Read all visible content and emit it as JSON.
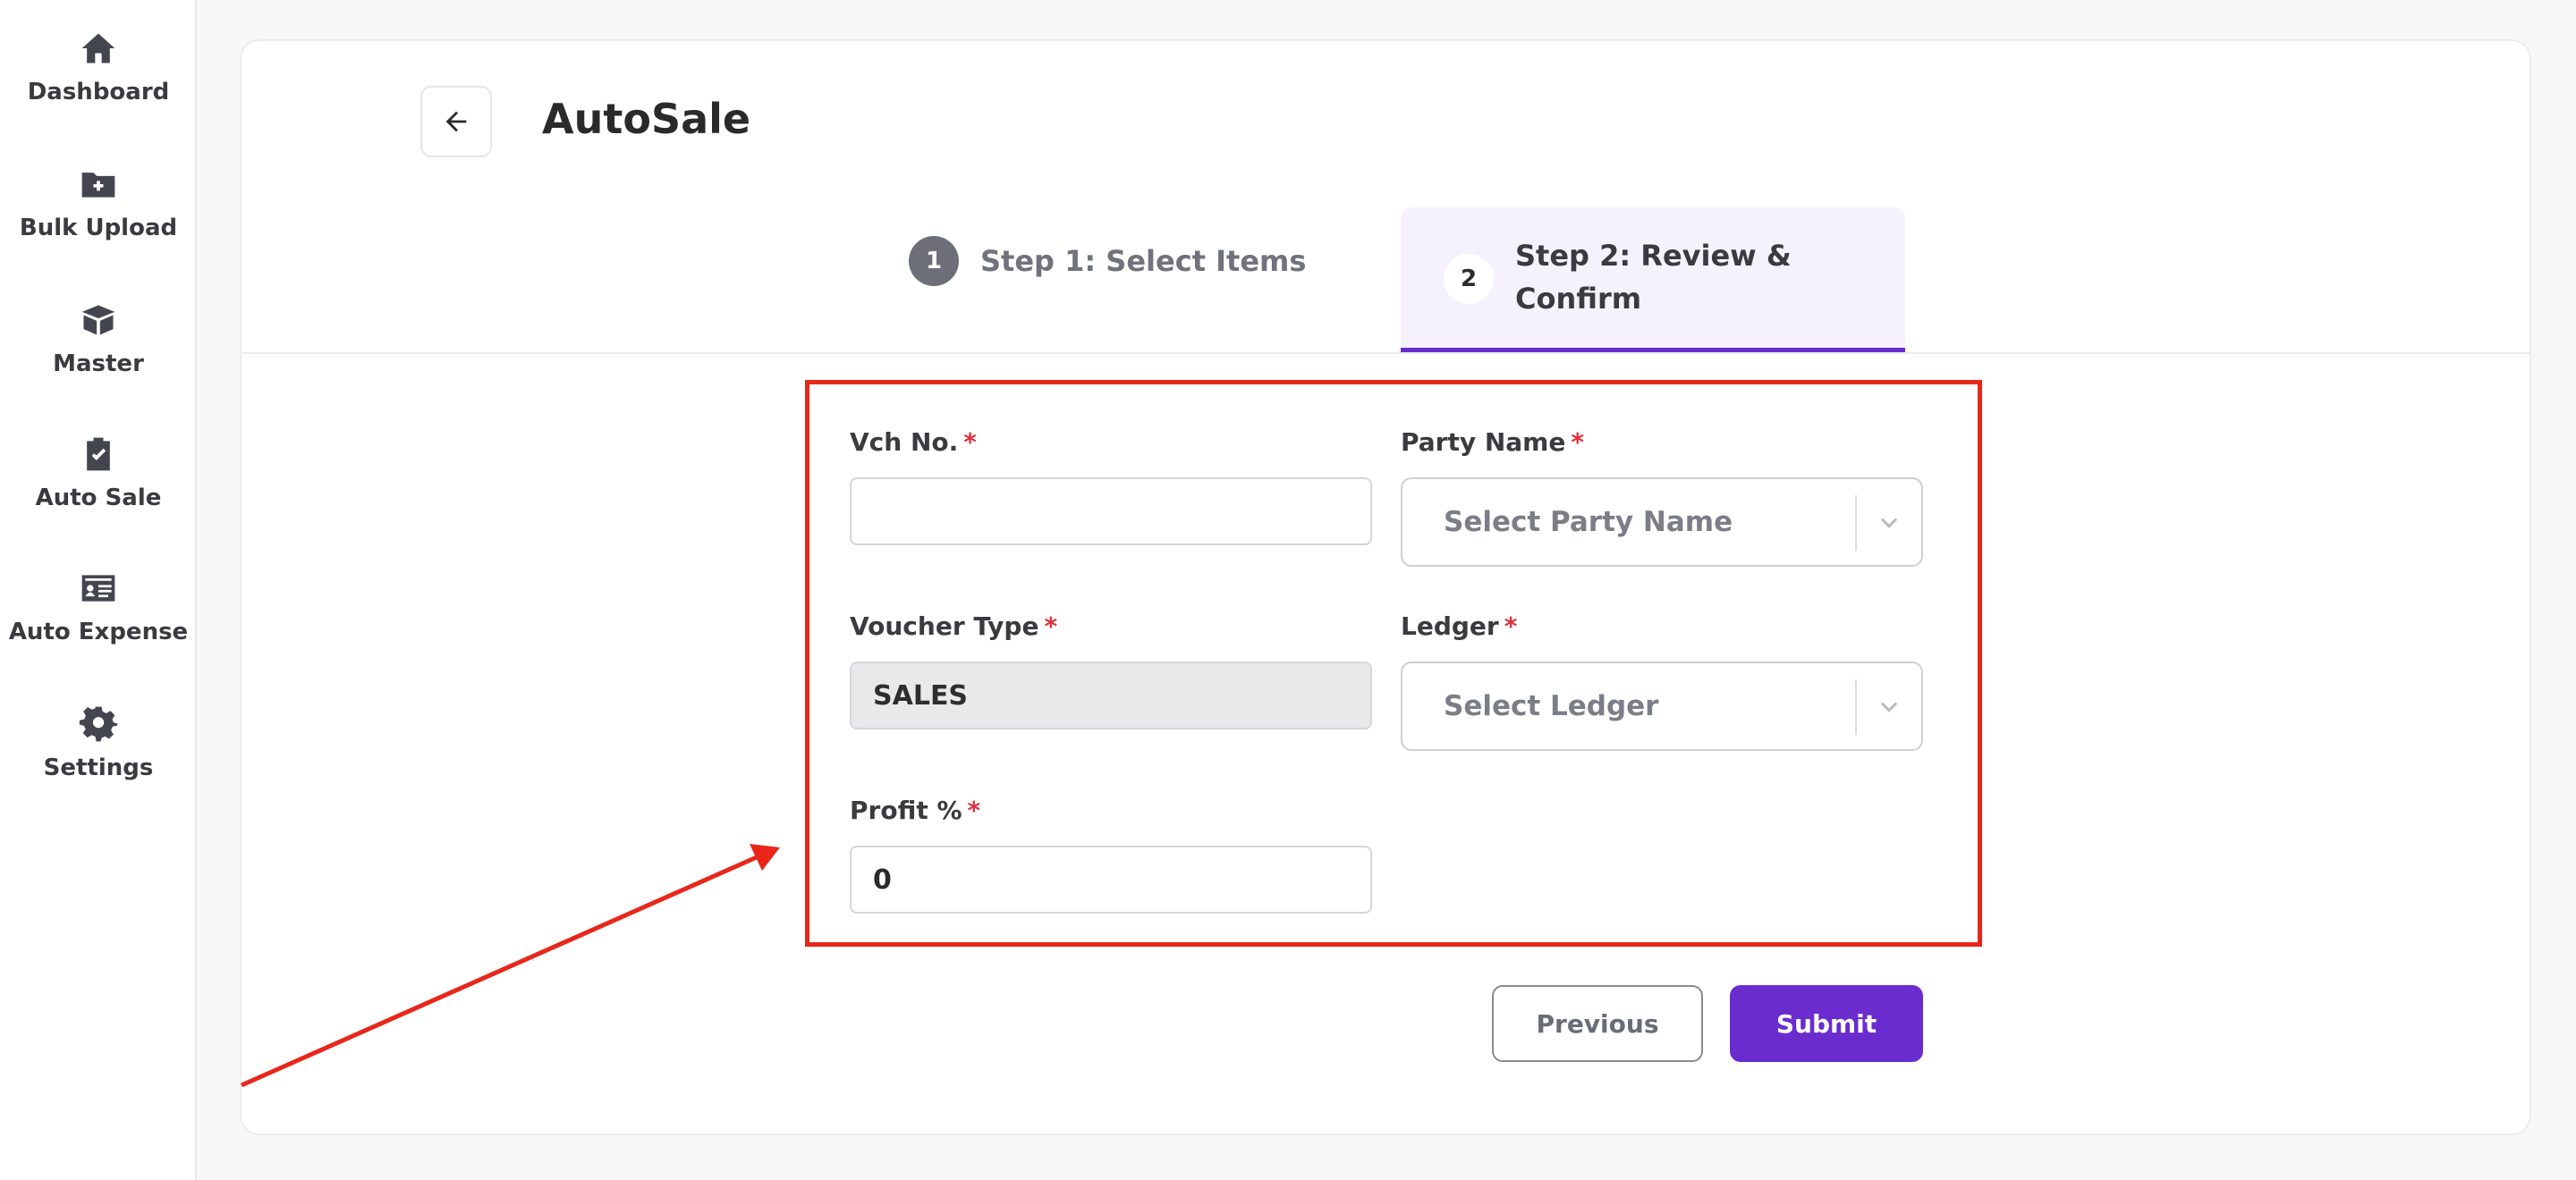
{
  "sidebar": {
    "items": [
      {
        "label": "Dashboard",
        "icon": "home-icon"
      },
      {
        "label": "Bulk Upload",
        "icon": "folder-plus-icon"
      },
      {
        "label": "Master",
        "icon": "box-open-icon"
      },
      {
        "label": "Auto Sale",
        "icon": "clipboard-check-icon"
      },
      {
        "label": "Auto Expense",
        "icon": "id-card-icon"
      },
      {
        "label": "Settings",
        "icon": "gear-icon"
      }
    ]
  },
  "header": {
    "back_icon": "arrow-left-icon",
    "title": "AutoSale"
  },
  "steps": [
    {
      "number": "1",
      "label": "Step 1: Select Items",
      "active": false
    },
    {
      "number": "2",
      "label": "Step 2: Review & Confirm",
      "active": true
    }
  ],
  "form": {
    "vch_no": {
      "label": "Vch No.",
      "required": "*",
      "value": ""
    },
    "party_name": {
      "label": "Party Name",
      "required": "*",
      "placeholder": "Select Party Name"
    },
    "voucher_type": {
      "label": "Voucher Type",
      "required": "*",
      "value": "SALES"
    },
    "ledger": {
      "label": "Ledger",
      "required": "*",
      "placeholder": "Select Ledger"
    },
    "profit": {
      "label": "Profit %",
      "required": "*",
      "value": "0"
    }
  },
  "actions": {
    "previous_label": "Previous",
    "submit_label": "Submit"
  },
  "colors": {
    "accent": "#6a2ccf",
    "annotation": "#e8271a",
    "required": "#e0313c"
  }
}
